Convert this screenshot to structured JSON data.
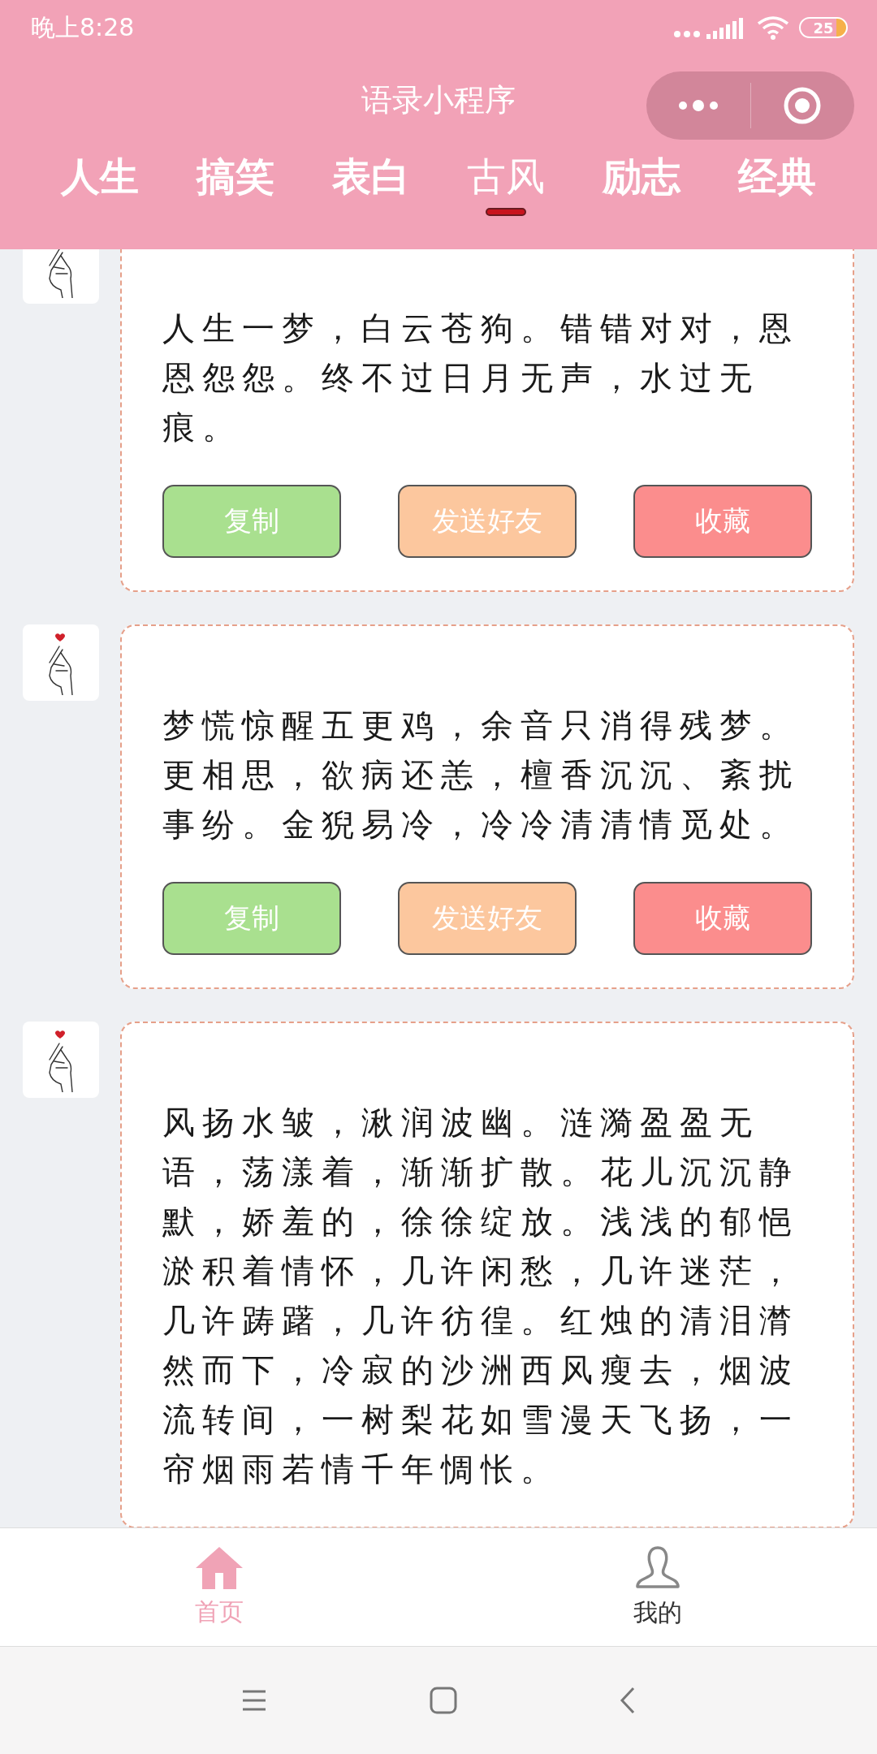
{
  "status_bar": {
    "time": "晚上8:28",
    "battery": "25"
  },
  "header": {
    "title": "语录小程序"
  },
  "tabs": [
    {
      "label": "人生",
      "selected": false
    },
    {
      "label": "搞笑",
      "selected": false
    },
    {
      "label": "表白",
      "selected": false
    },
    {
      "label": "古风",
      "selected": true
    },
    {
      "label": "励志",
      "selected": false
    },
    {
      "label": "经典",
      "selected": false
    }
  ],
  "quotes": [
    {
      "text": "人生一梦，白云苍狗。错错对对，恩恩怨怨。终不过日月无声，水过无痕。",
      "buttons": [
        {
          "label": "复制",
          "kind": "copy"
        },
        {
          "label": "发送好友",
          "kind": "share"
        },
        {
          "label": "收藏",
          "kind": "favorite"
        }
      ]
    },
    {
      "text": "梦慌惊醒五更鸡，余音只消得残梦。更相思，欲病还恙，檀香沉沉、紊扰事纷。金猊易冷，冷冷清清情觅处。",
      "buttons": [
        {
          "label": "复制",
          "kind": "copy"
        },
        {
          "label": "发送好友",
          "kind": "share"
        },
        {
          "label": "收藏",
          "kind": "favorite"
        }
      ]
    },
    {
      "text": "风扬水皱，湫润波幽。涟漪盈盈无语，荡漾着，渐渐扩散。花儿沉沉静默，娇羞的，徐徐绽放。浅浅的郁悒淤积着情怀，几许闲愁，几许迷茫，几许踌躇，几许彷徨。红烛的清泪潸然而下，冷寂的沙洲西风瘦去，烟波流转间，一树梨花如雪漫天飞扬，一帘烟雨若情千年惆怅。"
    }
  ],
  "bottom_nav": [
    {
      "label": "首页",
      "kind": "home",
      "selected": true
    },
    {
      "label": "我的",
      "kind": "profile",
      "selected": false
    }
  ]
}
